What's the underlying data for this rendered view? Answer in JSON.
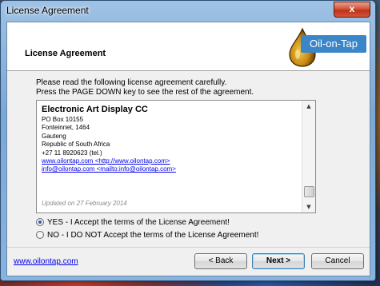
{
  "window": {
    "title": "License Agreement",
    "close_glyph": "x"
  },
  "header": {
    "title": "License Agreement",
    "logo_text": "Oil-on-Tap",
    "logo_icon": "oil-drop-icon"
  },
  "intro": {
    "line1": "Please read the following license agreement carefully.",
    "line2": "Press the PAGE DOWN key to see the rest of the agreement."
  },
  "license": {
    "company": "Electronic Art Display CC",
    "lines": [
      "PO Box 10155",
      "Fonteinriet, 1464",
      "Gauteng",
      "Republic of South Africa",
      "+27 11 8920623 (tel.)"
    ],
    "link_web": "www.oilontap.com <http://www.oilontap.com>",
    "link_mail": "info@oilontap.com <mailto:info@oilontap.com>",
    "updated": "Updated on 27 February 2014"
  },
  "options": {
    "accept": "YES - I Accept the terms of the License Agreement!",
    "decline": "NO - I DO NOT Accept the terms of the License Agreement!"
  },
  "footer": {
    "link": "www.oilontap.com",
    "back": "< Back",
    "next": "Next >",
    "cancel": "Cancel"
  }
}
